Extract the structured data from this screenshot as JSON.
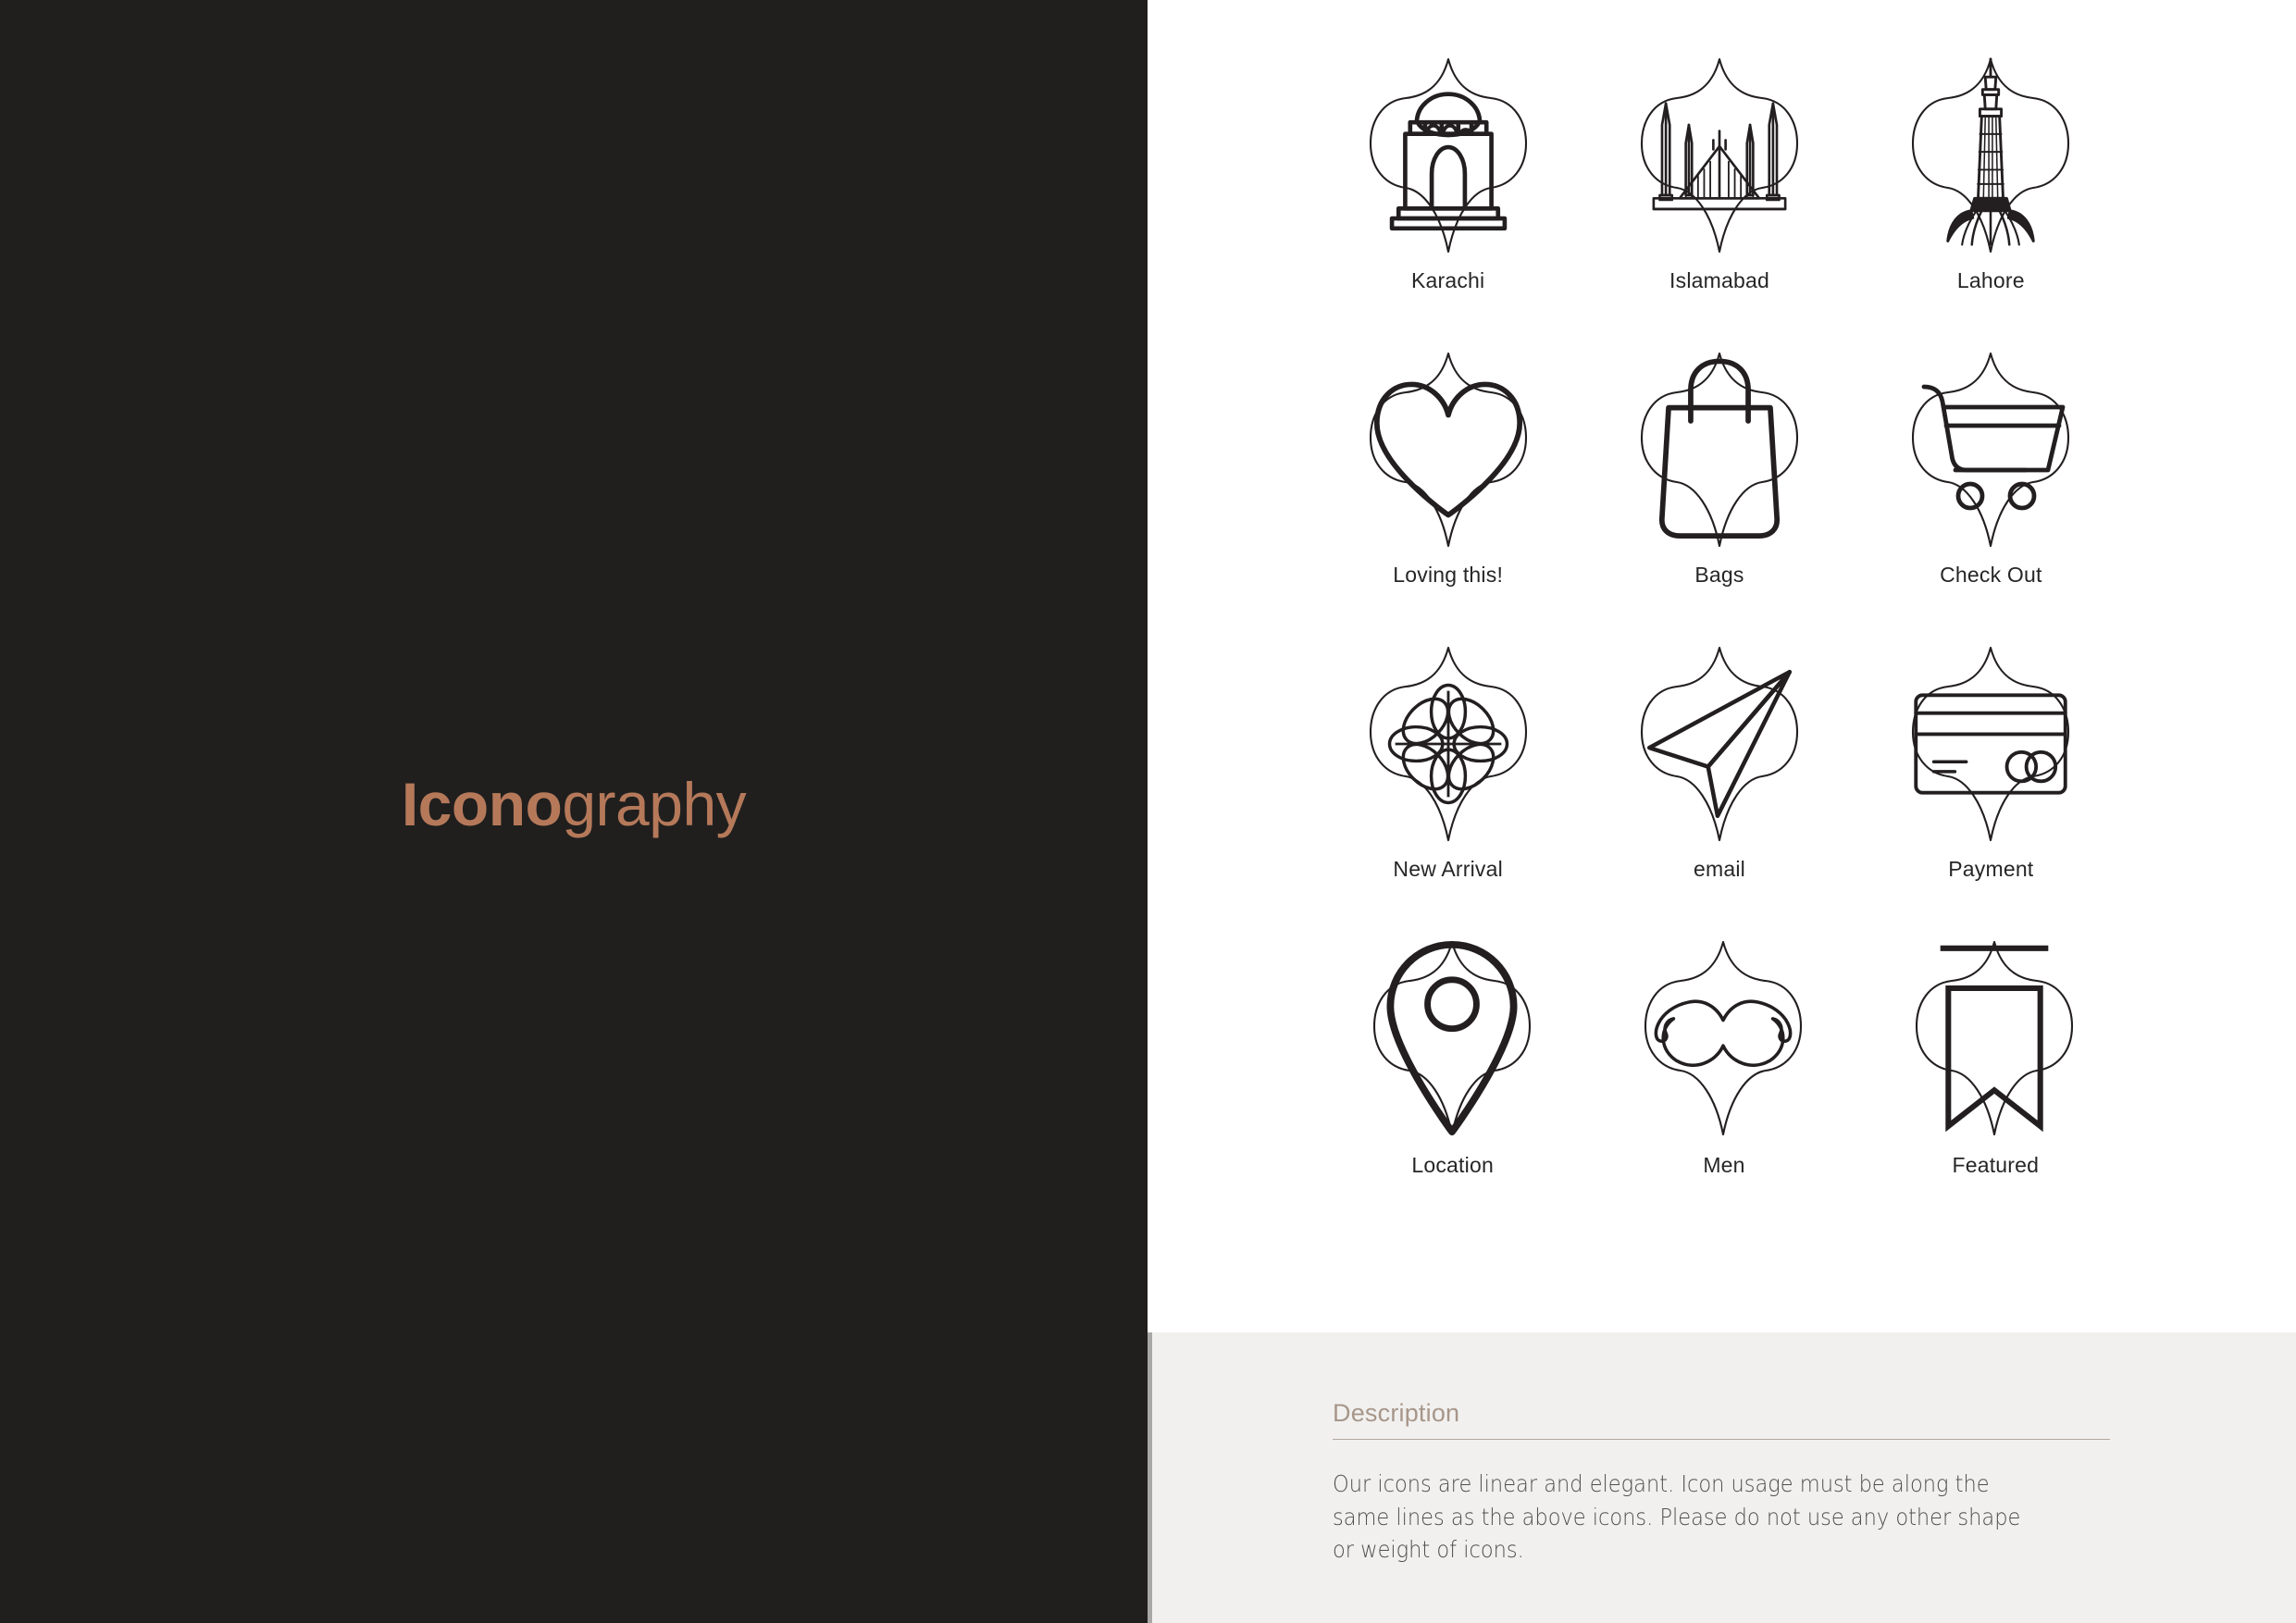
{
  "cover": {
    "title_bold": "Icono",
    "title_light": "graphy",
    "accent_color": "#b5795a",
    "background_color": "#201f1e"
  },
  "icon_grid": {
    "rows": [
      [
        {
          "label": "Karachi",
          "icon": "mausoleum-icon"
        },
        {
          "label": "Islamabad",
          "icon": "faisal-mosque-icon"
        },
        {
          "label": "Lahore",
          "icon": "minar-tower-icon"
        }
      ],
      [
        {
          "label": "Loving this!",
          "icon": "heart-icon"
        },
        {
          "label": "Bags",
          "icon": "shopping-bag-icon"
        },
        {
          "label": "Check Out",
          "icon": "shopping-cart-icon"
        }
      ],
      [
        {
          "label": "New Arrival",
          "icon": "flower-icon"
        },
        {
          "label": "email",
          "icon": "paper-plane-icon"
        },
        {
          "label": "Payment",
          "icon": "credit-card-icon"
        }
      ],
      [
        {
          "label": "Location",
          "icon": "map-pin-icon"
        },
        {
          "label": "Men",
          "icon": "moustache-icon"
        },
        {
          "label": "Featured",
          "icon": "bookmark-icon"
        }
      ]
    ],
    "frame_shape": "quatrefoil-ogee-frame",
    "stroke_color": "#231f20",
    "label_color": "#262626"
  },
  "description": {
    "heading": "Description",
    "body": "Our icons are linear and elegant. Icon usage must be along the same lines as the above icons. Please do not use any other shape or weight of icons.",
    "heading_color": "#a79689",
    "background_color": "#f1f0ef"
  }
}
